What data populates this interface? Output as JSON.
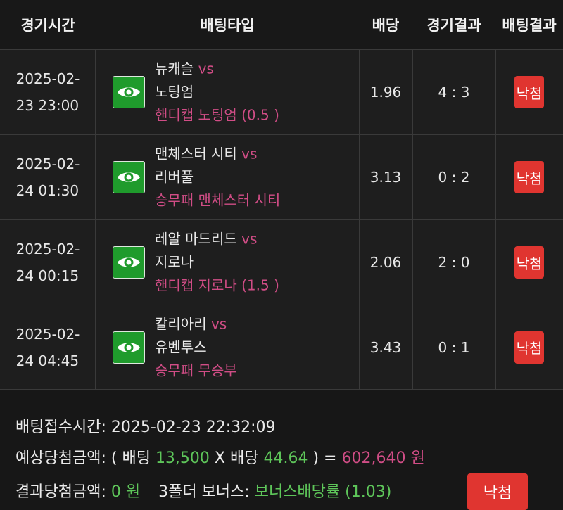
{
  "header": {
    "time": "경기시간",
    "type": "배팅타입",
    "odds": "배당",
    "game_result": "경기결과",
    "bet_result": "배팅결과"
  },
  "rows": [
    {
      "date": "2025-02-",
      "time": "23 23:00",
      "home": "뉴캐슬",
      "vs": "vs",
      "away": "노팅엄",
      "pick": "핸디캡 노팅엄 (0.5 )",
      "odds": "1.96",
      "score": "4 : 3",
      "result": "낙첨"
    },
    {
      "date": "2025-02-",
      "time": "24 01:30",
      "home": "맨체스터 시티",
      "vs": "vs",
      "away": "리버풀",
      "pick": "승무패 맨체스터 시티",
      "odds": "3.13",
      "score": "0 : 2",
      "result": "낙첨"
    },
    {
      "date": "2025-02-",
      "time": "24 00:15",
      "home": "레알 마드리드",
      "vs": "vs",
      "away": "지로나",
      "pick": "핸디캡 지로나 (1.5 )",
      "odds": "2.06",
      "score": "2 : 0",
      "result": "낙첨"
    },
    {
      "date": "2025-02-",
      "time": "24 04:45",
      "home": "칼리아리",
      "vs": "vs",
      "away": "유벤투스",
      "pick": "승무패 무승부",
      "odds": "3.43",
      "score": "0 : 1",
      "result": "낙첨"
    }
  ],
  "summary": {
    "received_label": "배팅접수시간:",
    "received_value": "2025-02-23 22:32:09",
    "expected_label": "예상당첨금액:",
    "open_paren": "(",
    "bet_label": "배팅",
    "bet_amount": "13,500",
    "times": "X",
    "odds_label": "배당",
    "total_odds": "44.64",
    "close_paren_eq": ") =",
    "expected_amount": "602,640 원",
    "result_label": "결과당첨금액:",
    "result_amount": "0 원",
    "bonus_label": "3폴더 보너스:",
    "bonus_value": "보너스배당률 (1.03)",
    "final_result": "낙첨"
  },
  "colors": {
    "accent_pink": "#d14d86",
    "accent_green": "#5ec65a",
    "badge_red": "#e03530",
    "eye_green": "#1f9b2c"
  },
  "icons": {
    "view": "eye-icon"
  }
}
